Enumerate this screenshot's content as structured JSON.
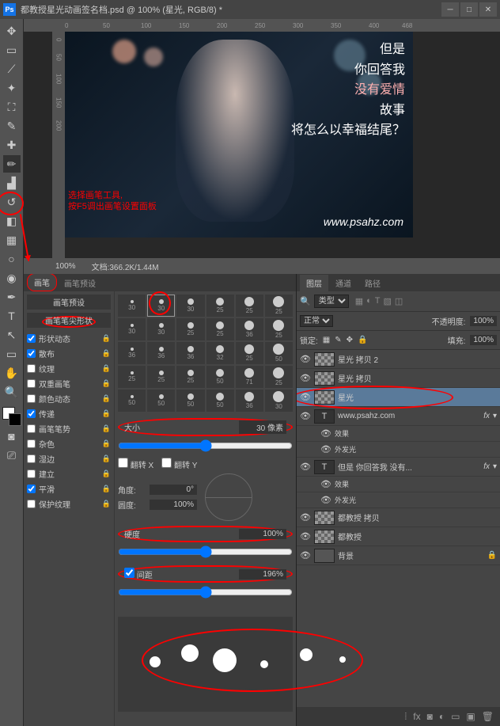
{
  "titlebar": {
    "ps": "Ps",
    "title": "都教授星光动画签名档.psd @ 100% (星光, RGB/8) *"
  },
  "ruler_h": [
    "0",
    "50",
    "100",
    "150",
    "200",
    "250",
    "300",
    "350",
    "400",
    "450",
    "468"
  ],
  "ruler_v": [
    "0",
    "50",
    "100",
    "150",
    "200"
  ],
  "canvas_text": {
    "l1": "但是",
    "l2": "你回答我",
    "l3": "没有爱情",
    "l4": "故事",
    "l5": "将怎么以幸福结尾？",
    "url": "www.psahz.com"
  },
  "annotation": {
    "l1": "选择画笔工具,",
    "l2": "按F5调出画笔设置面板"
  },
  "status": {
    "zoom": "100%",
    "doc": "文档:366.2K/1.44M"
  },
  "brush_panel": {
    "tab1": "画笔",
    "tab2": "画笔预设",
    "preset_btn": "画笔预设",
    "tip_btn": "画笔笔尖形状",
    "checks": [
      {
        "label": "形状动态",
        "on": true
      },
      {
        "label": "散布",
        "on": true
      },
      {
        "label": "纹理",
        "on": false
      },
      {
        "label": "双重画笔",
        "on": false
      },
      {
        "label": "颜色动态",
        "on": false
      },
      {
        "label": "传递",
        "on": true
      },
      {
        "label": "画笔笔势",
        "on": false
      },
      {
        "label": "杂色",
        "on": false
      },
      {
        "label": "湿边",
        "on": false
      },
      {
        "label": "建立",
        "on": false
      },
      {
        "label": "平滑",
        "on": true
      },
      {
        "label": "保护纹理",
        "on": false
      }
    ],
    "tip_sizes": [
      "30",
      "30",
      "30",
      "25",
      "25",
      "25",
      "30",
      "30",
      "25",
      "25",
      "36",
      "25",
      "36",
      "36",
      "36",
      "32",
      "25",
      "50",
      "25",
      "25",
      "25",
      "50",
      "71",
      "25",
      "50",
      "50",
      "50",
      "50",
      "36",
      "30"
    ],
    "size_label": "大小",
    "size_val": "30 像素",
    "flipx": "翻转 X",
    "flipy": "翻转 Y",
    "angle_label": "角度:",
    "angle_val": "0°",
    "round_label": "圆度:",
    "round_val": "100%",
    "hard_label": "硬度",
    "hard_val": "100%",
    "spacing_label": "间距",
    "spacing_val": "196%"
  },
  "layers_panel": {
    "tabs": [
      "图层",
      "通道",
      "路径"
    ],
    "kind": "类型",
    "blend": "正常",
    "opacity_label": "不透明度:",
    "opacity_val": "100%",
    "lock_label": "锁定:",
    "fill_label": "填充:",
    "fill_val": "100%",
    "layers": [
      {
        "name": "星光 拷贝 2",
        "type": "normal"
      },
      {
        "name": "星光 拷贝",
        "type": "normal"
      },
      {
        "name": "星光",
        "type": "normal",
        "sel": true,
        "oval": true
      },
      {
        "name": "www.psahz.com",
        "type": "text",
        "fx": true
      },
      {
        "name": "效果",
        "type": "sub"
      },
      {
        "name": "外发光",
        "type": "sub"
      },
      {
        "name": "但是 你回答我 没有...",
        "type": "text",
        "fx": true
      },
      {
        "name": "效果",
        "type": "sub"
      },
      {
        "name": "外发光",
        "type": "sub"
      },
      {
        "name": "都教授 拷贝",
        "type": "img"
      },
      {
        "name": "都教授",
        "type": "img"
      },
      {
        "name": "背景",
        "type": "bg"
      }
    ]
  }
}
